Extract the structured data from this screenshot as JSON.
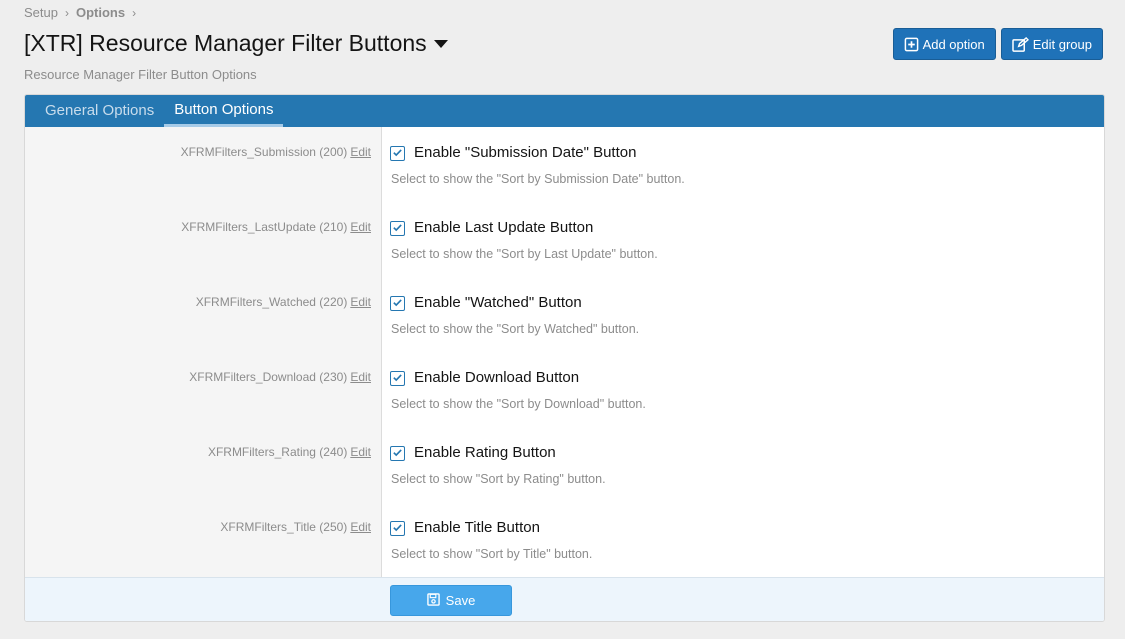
{
  "breadcrumb": {
    "items": [
      "Setup",
      "Options"
    ]
  },
  "header": {
    "title": "[XTR] Resource Manager Filter Buttons",
    "subtitle": "Resource Manager Filter Button Options",
    "add_option_label": "Add option",
    "edit_group_label": "Edit group"
  },
  "tabs": [
    {
      "label": "General Options",
      "active": false
    },
    {
      "label": "Button Options",
      "active": true
    }
  ],
  "options": [
    {
      "id": "XFRMFilters_Submission (200)",
      "edit": "Edit",
      "title": "Enable \"Submission Date\" Button",
      "desc": "Select to show the \"Sort by Submission Date\" button.",
      "checked": true
    },
    {
      "id": "XFRMFilters_LastUpdate (210)",
      "edit": "Edit",
      "title": "Enable Last Update Button",
      "desc": "Select to show the \"Sort by Last Update\" button.",
      "checked": true
    },
    {
      "id": "XFRMFilters_Watched (220)",
      "edit": "Edit",
      "title": "Enable \"Watched\" Button",
      "desc": "Select to show the \"Sort by Watched\" button.",
      "checked": true
    },
    {
      "id": "XFRMFilters_Download (230)",
      "edit": "Edit",
      "title": "Enable Download Button",
      "desc": "Select to show the \"Sort by Download\" button.",
      "checked": true
    },
    {
      "id": "XFRMFilters_Rating (240)",
      "edit": "Edit",
      "title": "Enable Rating Button",
      "desc": "Select to show \"Sort by Rating\" button.",
      "checked": true
    },
    {
      "id": "XFRMFilters_Title (250)",
      "edit": "Edit",
      "title": "Enable Title Button",
      "desc": "Select to show \"Sort by Title\" button.",
      "checked": true
    }
  ],
  "footer": {
    "save_label": "Save"
  },
  "colors": {
    "accent": "#2577b1",
    "button": "#1f72b8",
    "save": "#47a7eb"
  },
  "icons": {
    "add": "plus-square-icon",
    "edit": "edit-icon",
    "save": "floppy-disk-icon",
    "caret": "caret-down-icon",
    "check": "checkbox-checked-icon"
  }
}
